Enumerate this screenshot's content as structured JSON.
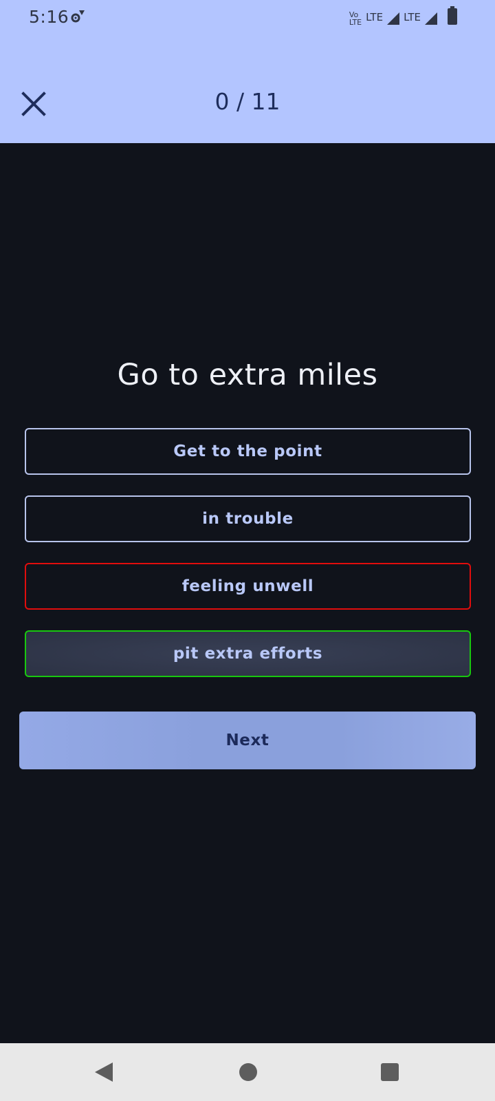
{
  "status_bar": {
    "time": "5:16",
    "network_left": "LTE",
    "network_right": "LTE",
    "volte_top": "Vo",
    "volte_bottom": "LTE",
    "icons": [
      "settings-gear-icon",
      "signal-icon",
      "signal-icon",
      "battery-icon"
    ]
  },
  "header": {
    "progress": "0 / 11",
    "close_icon": "close-icon",
    "background": "#b3c5ff"
  },
  "quiz": {
    "question": "Go to extra miles",
    "options": [
      {
        "label": "Get to the point",
        "state": "neutral"
      },
      {
        "label": "in trouble",
        "state": "neutral"
      },
      {
        "label": "feeling unwell",
        "state": "wrong"
      },
      {
        "label": "pit extra efforts",
        "state": "correct"
      }
    ],
    "next_label": "Next"
  },
  "colors": {
    "background": "#10131b",
    "wrong_border": "#e10d0d",
    "correct_border": "#19c80f",
    "accent": "#8aa0dc"
  },
  "nav_bar": {
    "icons": [
      "back-icon",
      "home-icon",
      "recents-icon"
    ]
  }
}
